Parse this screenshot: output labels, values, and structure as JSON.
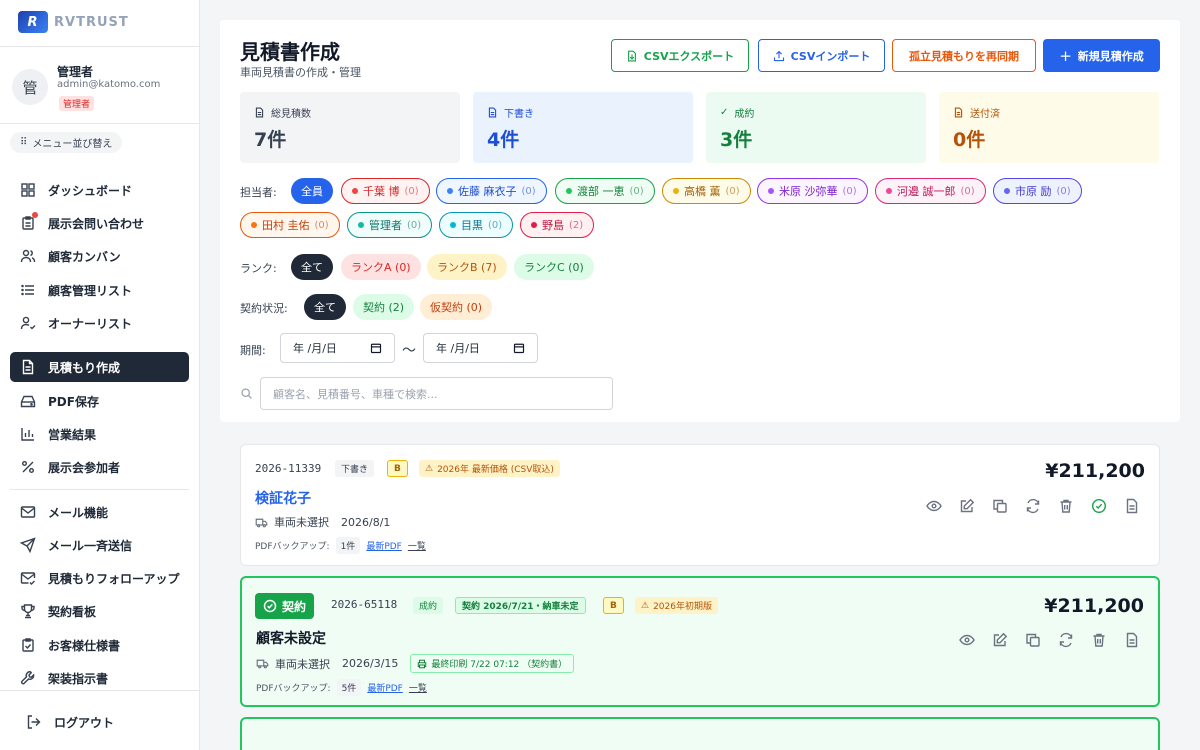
{
  "app": {
    "logo_text": "RVTRUST"
  },
  "user": {
    "avatar": "管",
    "name": "管理者",
    "email": "admin@katomo.com",
    "role": "管理者"
  },
  "sidebar": {
    "reorder_label": "メニュー並び替え",
    "items": [
      {
        "label": "ダッシュボード",
        "icon": "dashboard-icon"
      },
      {
        "label": "展示会問い合わせ",
        "icon": "clipboard-icon"
      },
      {
        "label": "顧客カンバン",
        "icon": "users-icon"
      },
      {
        "label": "顧客管理リスト",
        "icon": "list-icon"
      },
      {
        "label": "オーナーリスト",
        "icon": "user-check-icon"
      },
      {
        "label": "見積もり作成",
        "icon": "document-icon"
      },
      {
        "label": "PDF保存",
        "icon": "drive-icon"
      },
      {
        "label": "営業結果",
        "icon": "bar-chart-icon"
      },
      {
        "label": "展示会参加者",
        "icon": "percent-icon"
      },
      {
        "label": "メール機能",
        "icon": "mail-icon"
      },
      {
        "label": "メール一斉送信",
        "icon": "send-icon"
      },
      {
        "label": "見積もりフォローアップ",
        "icon": "mail-check-icon"
      },
      {
        "label": "契約看板",
        "icon": "trophy-icon"
      },
      {
        "label": "お客様仕様書",
        "icon": "clipboard-check-icon"
      },
      {
        "label": "架装指示書",
        "icon": "wrench-icon"
      }
    ],
    "logout": "ログアウト"
  },
  "page": {
    "title": "見積書作成",
    "subtitle": "車両見積書の作成・管理",
    "buttons": {
      "csv_export": "CSVエクスポート",
      "csv_import": "CSVインポート",
      "resync": "孤立見積もりを再同期",
      "new": "新規見積作成"
    }
  },
  "stats": [
    {
      "label": "総見積数",
      "value": "7件"
    },
    {
      "label": "下書き",
      "value": "4件"
    },
    {
      "label": "成約",
      "value": "3件"
    },
    {
      "label": "送付済",
      "value": "0件"
    }
  ],
  "filters": {
    "owner_label": "担当者:",
    "owners": [
      {
        "name": "全員",
        "count": ""
      },
      {
        "name": "千葉 博",
        "count": "(0)",
        "color": "#ef4444"
      },
      {
        "name": "佐藤 麻衣子",
        "count": "(0)",
        "color": "#3b82f6"
      },
      {
        "name": "渡部 一恵",
        "count": "(0)",
        "color": "#22c55e"
      },
      {
        "name": "高橋 薫",
        "count": "(0)",
        "color": "#eab308"
      },
      {
        "name": "米原 沙弥華",
        "count": "(0)",
        "color": "#a855f7"
      },
      {
        "name": "河邉 誠一郎",
        "count": "(0)",
        "color": "#ec4899"
      },
      {
        "name": "市原 励",
        "count": "(0)",
        "color": "#6366f1"
      },
      {
        "name": "田村 圭佑",
        "count": "(0)",
        "color": "#f97316"
      },
      {
        "name": "管理者",
        "count": "(0)",
        "color": "#14b8a6"
      },
      {
        "name": "目黒",
        "count": "(0)",
        "color": "#06b6d4"
      },
      {
        "name": "野島",
        "count": "(2)",
        "color": "#e11d48"
      }
    ],
    "rank_label": "ランク:",
    "ranks": [
      "全て",
      "ランクA (0)",
      "ランクB (7)",
      "ランクC (0)"
    ],
    "contract_label": "契約状況:",
    "contracts": [
      "全て",
      "契約 (2)",
      "仮契約 (0)"
    ],
    "period_label": "期間:",
    "date_placeholder": "年 /月/日",
    "tilde": "〜",
    "search_placeholder": "顧客名、見積番号、車種で検索..."
  },
  "quotes": [
    {
      "number": "2026-11339",
      "status": "下書き",
      "rank": "B",
      "warn": "2026年 最新価格 (CSV取込)",
      "price": "¥211,200",
      "customer": "検証花子",
      "vehicle": "車両未選択",
      "date": "2026/8/1",
      "pdf_label": "PDFバックアップ:",
      "pdf_count": "1件",
      "pdf_latest": "最新PDF",
      "pdf_list": "一覧"
    },
    {
      "badge": "契約",
      "number": "2026-65118",
      "status": "成約",
      "contract": "契約 2026/7/21・納車未定",
      "rank": "B",
      "warn": "2026年初期版",
      "price": "¥211,200",
      "customer": "顧客未設定",
      "vehicle": "車両未選択",
      "date": "2026/3/15",
      "print": "最終印刷 7/22 07:12 （契約書）",
      "pdf_label": "PDFバックアップ:",
      "pdf_count": "5件",
      "pdf_latest": "最新PDF",
      "pdf_list": "一覧"
    }
  ],
  "colors": {
    "primary": "#2563eb",
    "dark": "#1f2937",
    "green": "#16a34a",
    "orange": "#ea580c"
  }
}
